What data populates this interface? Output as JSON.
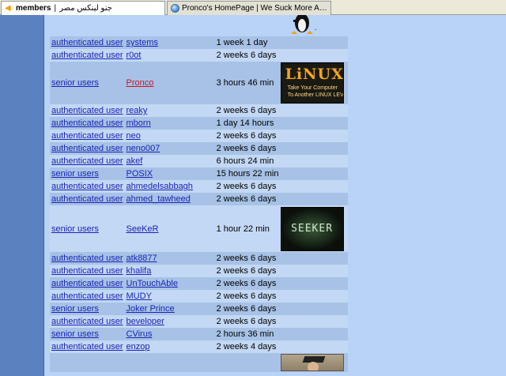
{
  "tabs": [
    {
      "title": "members",
      "subtitle": "جنو لينكس مصر",
      "separator": "|",
      "icon": "back-arrow-icon"
    },
    {
      "title": "Pronco's HomePage | We Suck More And Th...",
      "icon": "globe-icon"
    }
  ],
  "avatars": {
    "linux": {
      "big": "LiNUX",
      "line1": "Take Your Computer",
      "line2": "To Another LINUX LEVEL"
    },
    "seeker": {
      "text": "SEEKER"
    }
  },
  "rows": [
    {
      "role": "authenticated user",
      "user": "systems",
      "time": "1 week 1 day"
    },
    {
      "role": "authenticated user",
      "user": "r0ot",
      "time": "2 weeks 6 days"
    },
    {
      "role": "senior users",
      "user": "Pronco",
      "time": "3 hours 46 min",
      "avatar": "linux"
    },
    {
      "role": "authenticated user",
      "user": "reaky",
      "time": "2 weeks 6 days"
    },
    {
      "role": "authenticated user",
      "user": "mborn",
      "time": "1 day 14 hours"
    },
    {
      "role": "authenticated user",
      "user": "neo",
      "time": "2 weeks 6 days"
    },
    {
      "role": "authenticated user",
      "user": "neno007",
      "time": "2 weeks 6 days"
    },
    {
      "role": "authenticated user",
      "user": "akef",
      "time": "6 hours 24 min"
    },
    {
      "role": "senior users",
      "user": "POSIX",
      "time": "15 hours 22 min"
    },
    {
      "role": "authenticated user",
      "user": "ahmedelsabbagh",
      "time": "2 weeks 6 days"
    },
    {
      "role": "authenticated user",
      "user": "ahmed_tawheed",
      "time": "2 weeks 6 days"
    },
    {
      "role": "senior users",
      "user": "SeeKeR",
      "time": "1 hour 22 min",
      "avatar": "seeker"
    },
    {
      "role": "authenticated user",
      "user": "atk8877",
      "time": "2 weeks 6 days"
    },
    {
      "role": "authenticated user",
      "user": "khalifa",
      "time": "2 weeks 6 days"
    },
    {
      "role": "authenticated user",
      "user": "UnTouchAble",
      "time": "2 weeks 6 days"
    },
    {
      "role": "authenticated user",
      "user": "MUDY",
      "time": "2 weeks 6 days"
    },
    {
      "role": "senior users",
      "user": "Joker Prince",
      "time": "2 weeks 6 days"
    },
    {
      "role": "authenticated user",
      "user": "beveloper",
      "time": "2 weeks 6 days"
    },
    {
      "role": "senior users",
      "user": "CVirus",
      "time": "2 hours 36 min"
    },
    {
      "role": "authenticated user",
      "user": "enzop",
      "time": "2 weeks 4 days"
    },
    {
      "role": "",
      "user": "",
      "time": "",
      "avatar": "graduate"
    }
  ]
}
